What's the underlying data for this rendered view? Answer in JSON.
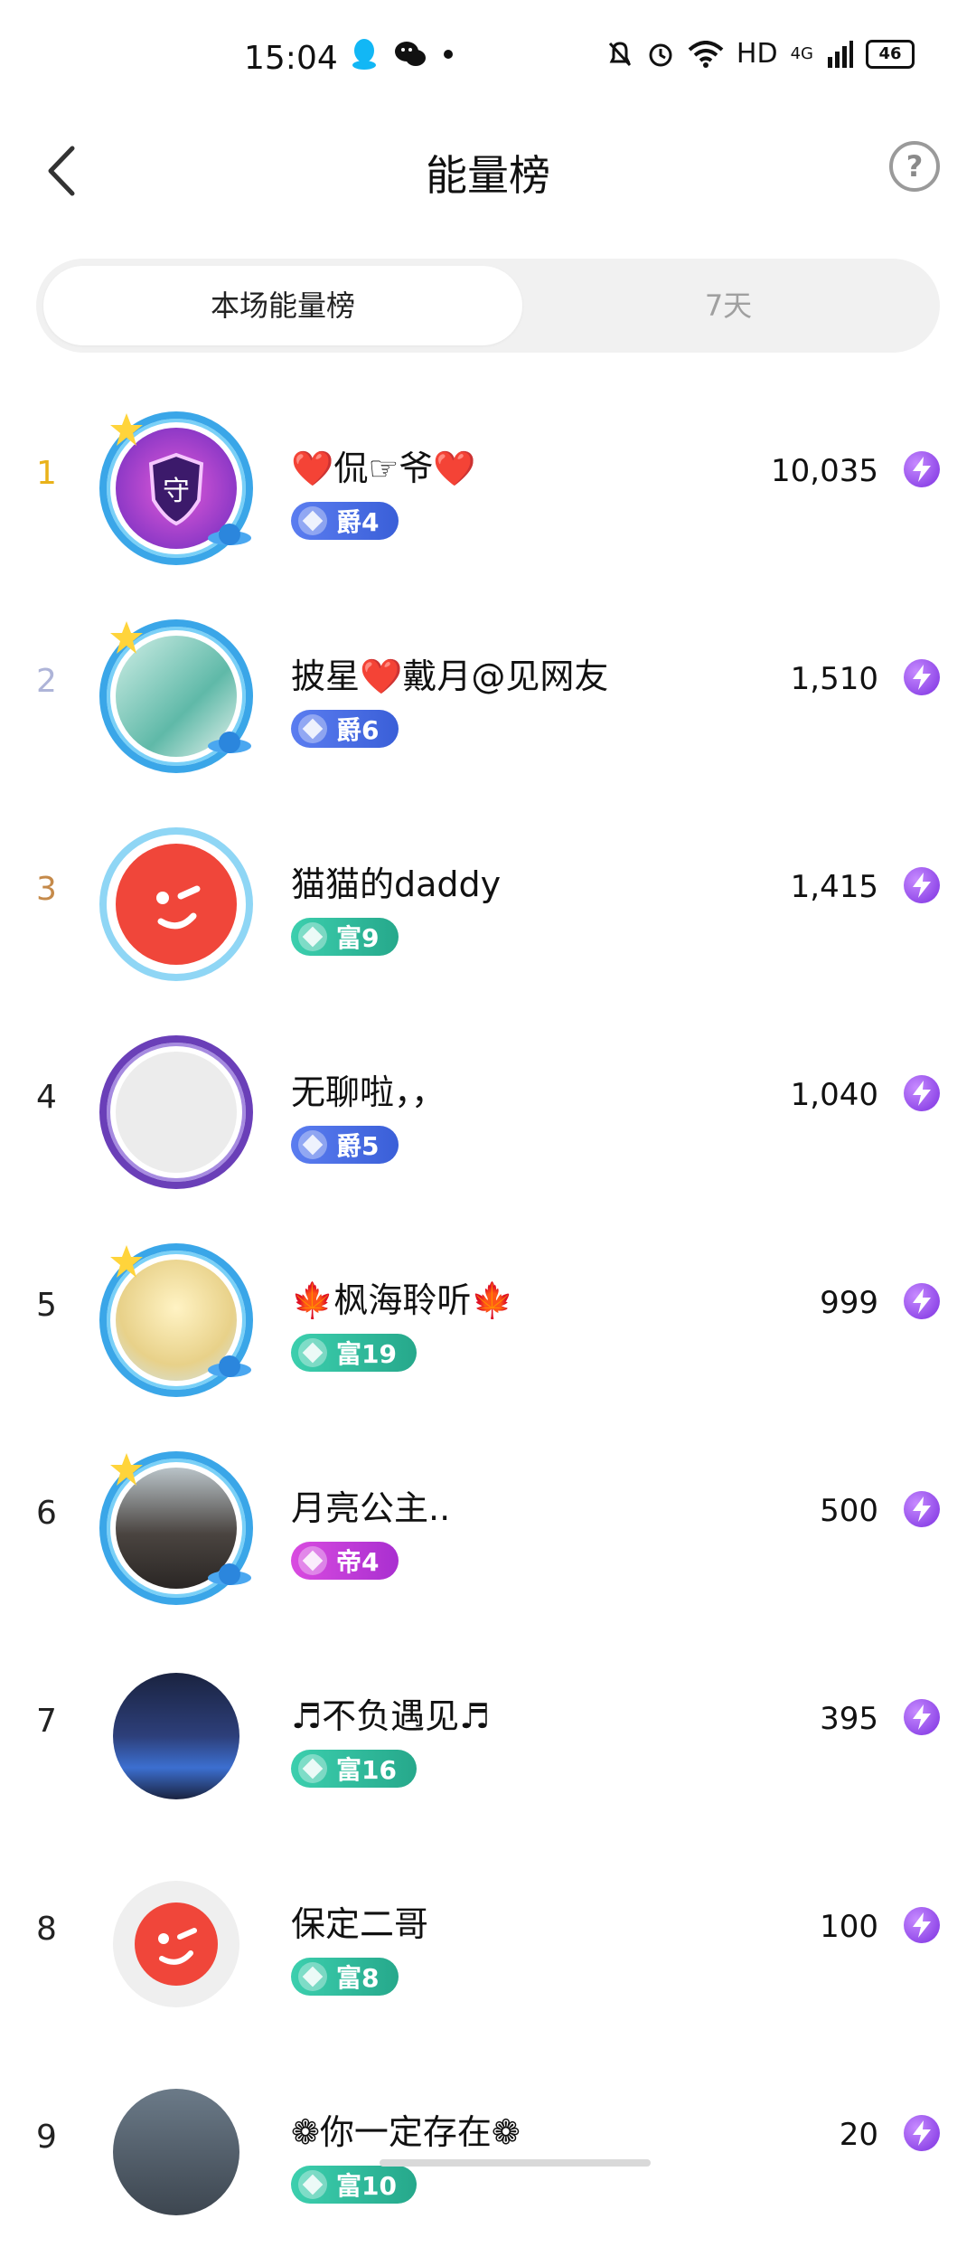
{
  "status": {
    "time": "15:04",
    "network": "HD",
    "signal": "4G",
    "battery": "46"
  },
  "header": {
    "title": "能量榜",
    "help": "?"
  },
  "tabs": [
    {
      "label": "本场能量榜",
      "active": true
    },
    {
      "label": "7天",
      "active": false
    }
  ],
  "rankings": [
    {
      "rank": "1",
      "name": "❤️侃☞爷❤️",
      "badge": "爵4",
      "badge_type": "jue",
      "score": "10,035",
      "rank_color": "#e9b21a"
    },
    {
      "rank": "2",
      "name": "披星❤️戴月@见网友",
      "badge": "爵6",
      "badge_type": "jue",
      "score": "1,510",
      "rank_color": "#aeb4d8"
    },
    {
      "rank": "3",
      "name": "猫猫的daddy",
      "badge": "富9",
      "badge_type": "fu",
      "score": "1,415",
      "rank_color": "#c58a4a"
    },
    {
      "rank": "4",
      "name": "无聊啦，，",
      "badge": "爵5",
      "badge_type": "jue",
      "score": "1,040",
      "rank_color": "#222222"
    },
    {
      "rank": "5",
      "name": "🍁枫海聆听🍁",
      "badge": "富19",
      "badge_type": "fu",
      "score": "999",
      "rank_color": "#222222"
    },
    {
      "rank": "6",
      "name": "月亮公主..",
      "badge": "帝4",
      "badge_type": "di",
      "score": "500",
      "rank_color": "#222222"
    },
    {
      "rank": "7",
      "name": "♬不负遇见♬",
      "badge": "富16",
      "badge_type": "fu",
      "score": "395",
      "rank_color": "#222222"
    },
    {
      "rank": "8",
      "name": "保定二哥",
      "badge": "富8",
      "badge_type": "fu",
      "score": "100",
      "rank_color": "#222222"
    },
    {
      "rank": "9",
      "name": "❁你一定存在❁",
      "badge": "富10",
      "badge_type": "fu",
      "score": "20",
      "rank_color": "#222222"
    }
  ],
  "colors": {
    "accent_purple": "#7b2fe0",
    "badge_jue": "#3a5fd8",
    "badge_fu": "#26a88b",
    "badge_di": "#a92fd0"
  }
}
